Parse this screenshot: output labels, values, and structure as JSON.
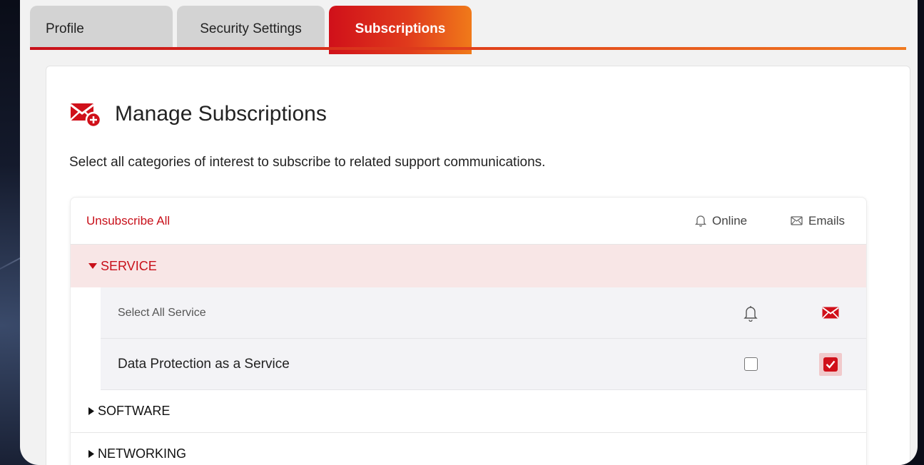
{
  "tabs": [
    {
      "label": "Profile",
      "active": false
    },
    {
      "label": "Security Settings",
      "active": false
    },
    {
      "label": "Subscriptions",
      "active": true
    }
  ],
  "card": {
    "title": "Manage Subscriptions",
    "description": "Select all categories of interest to subscribe to related support communications."
  },
  "table": {
    "unsubscribe_all": "Unsubscribe All",
    "col_online": "Online",
    "col_emails": "Emails",
    "groups": [
      {
        "label": "SERVICE",
        "expanded": true,
        "select_all_label": "Select All Service",
        "items": [
          {
            "label": "Data Protection as a Service",
            "online": false,
            "email": true
          }
        ]
      },
      {
        "label": "SOFTWARE",
        "expanded": false
      },
      {
        "label": "NETWORKING",
        "expanded": false
      }
    ]
  },
  "colors": {
    "accent": "#d0101a",
    "accent_orange": "#f07a1a",
    "expanded_bg": "#f8e6e6"
  },
  "icons": {
    "header": "mail-plus-icon",
    "online": "bell-icon",
    "emails": "envelope-icon",
    "expanded": "caret-down-icon",
    "collapsed": "caret-right-icon"
  }
}
